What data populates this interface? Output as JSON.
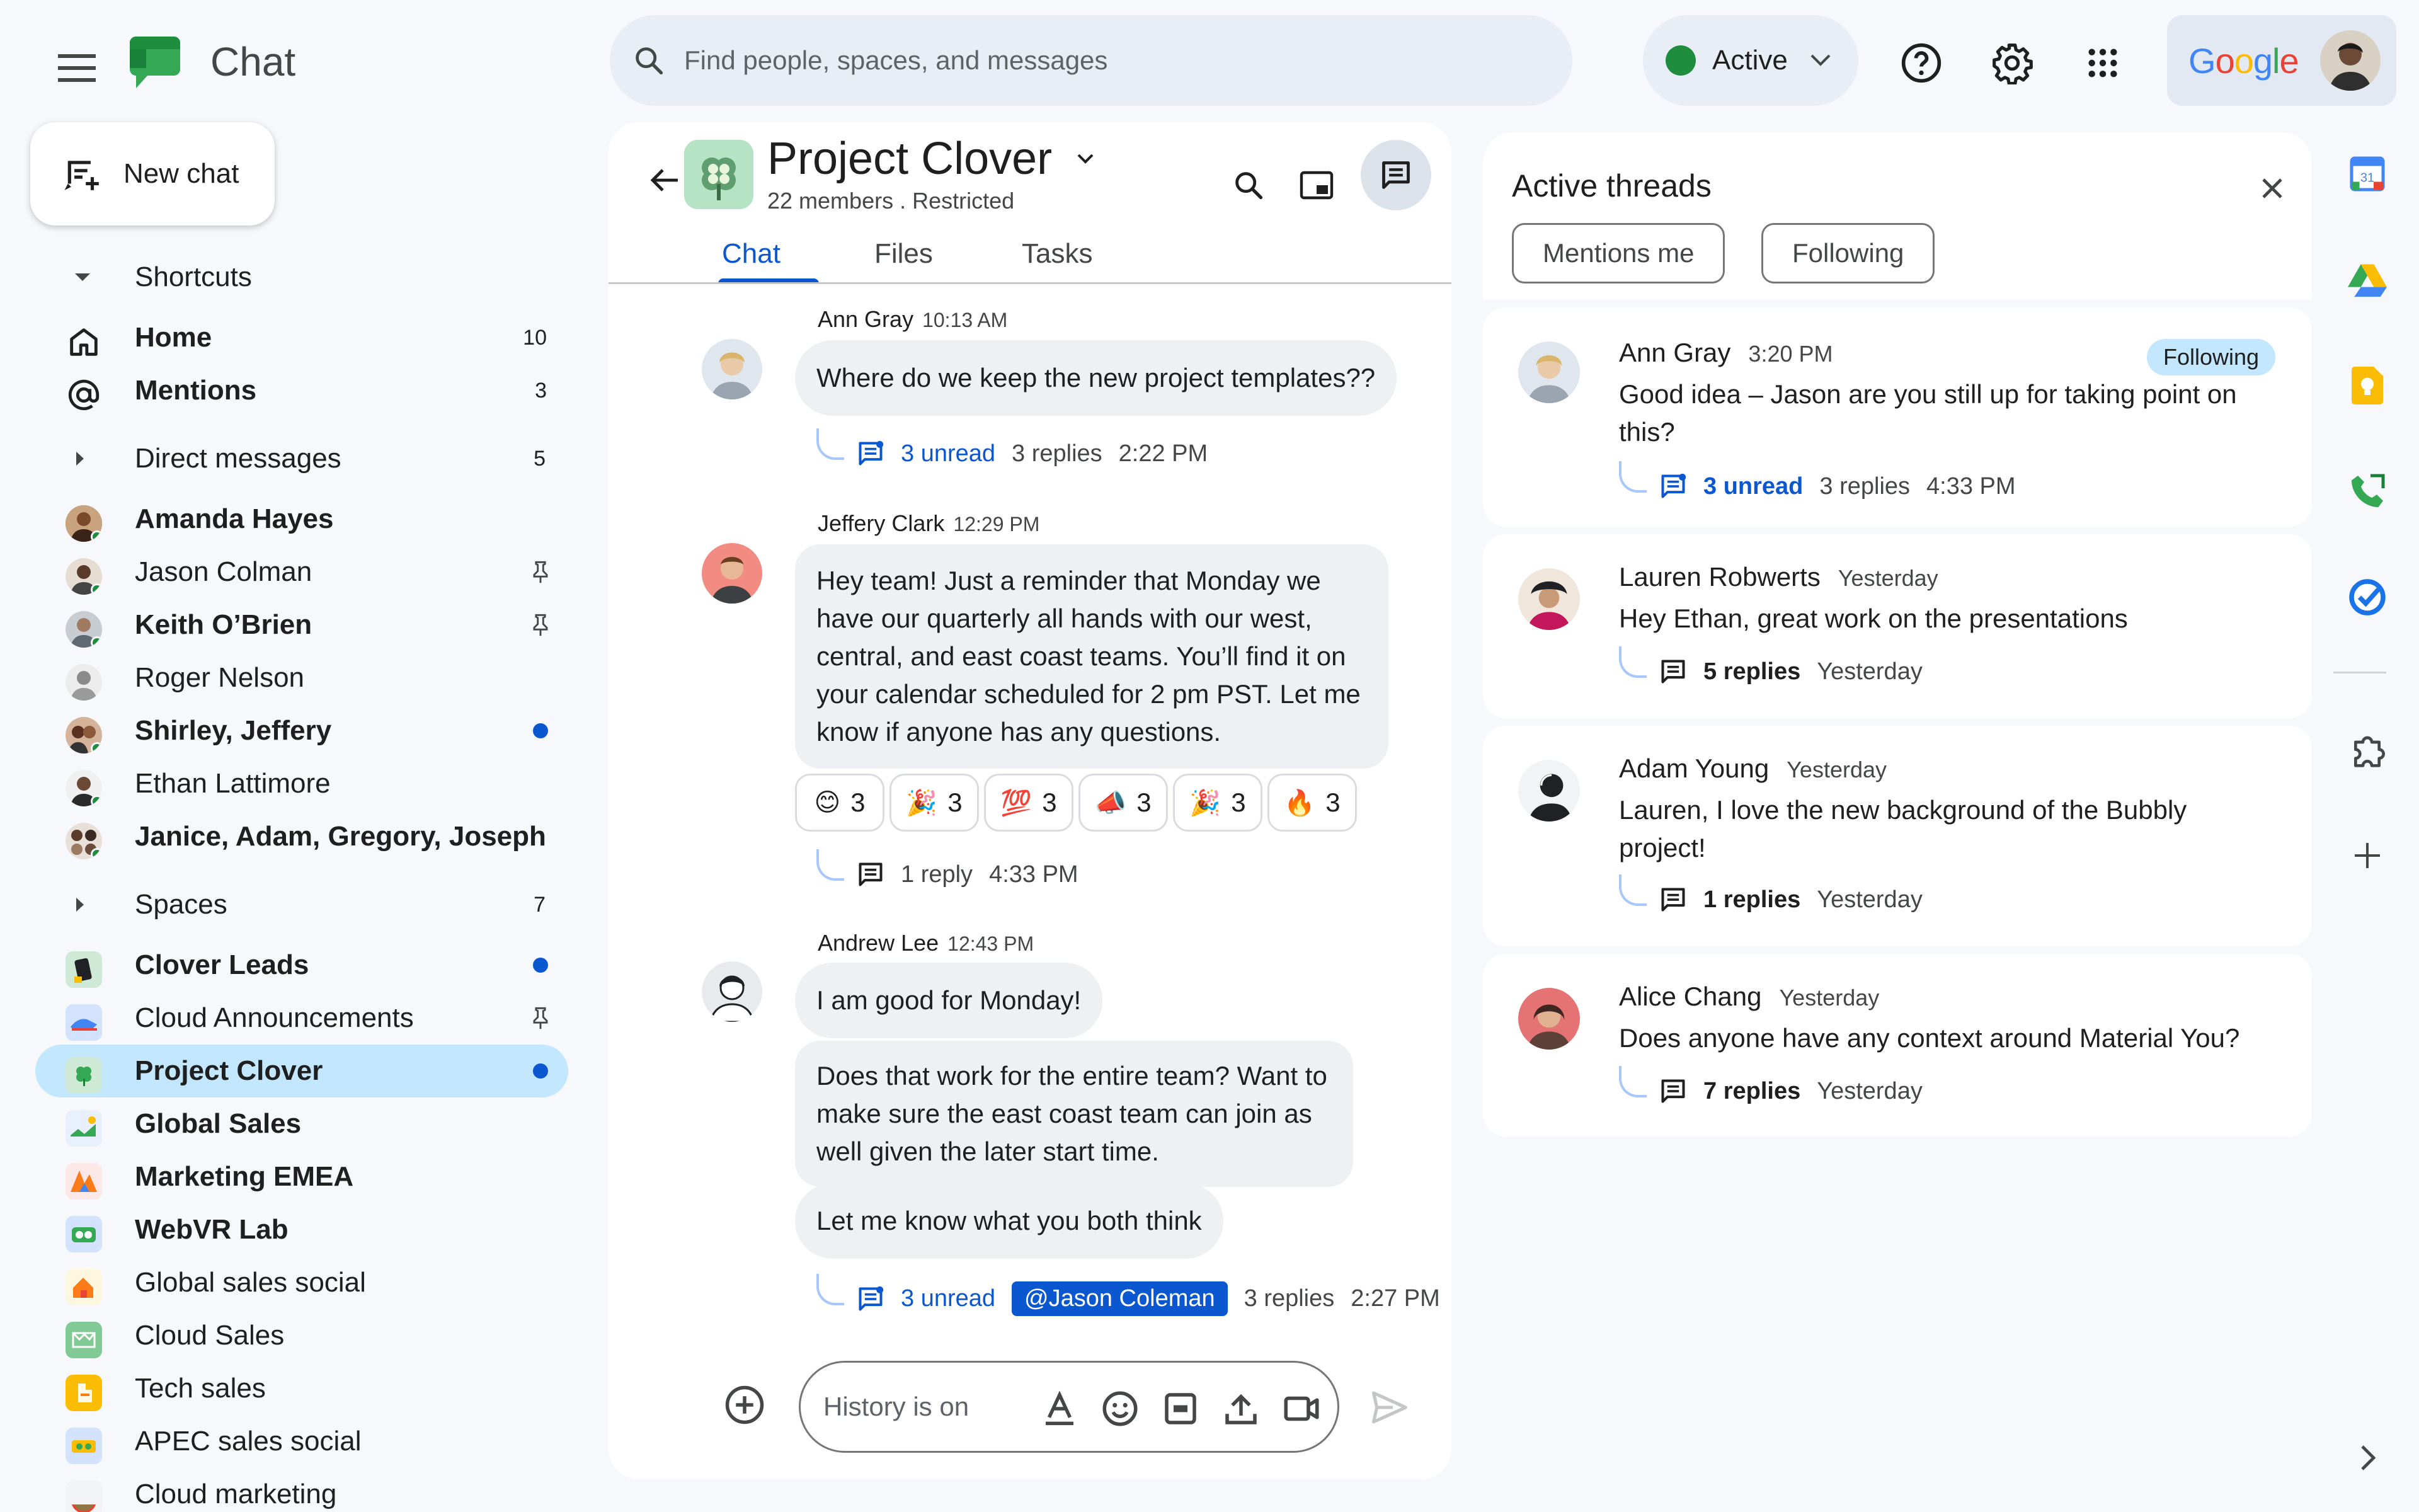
{
  "header": {
    "app_title": "Chat",
    "search_placeholder": "Find people, spaces, and messages",
    "status_label": "Active",
    "google_wordmark": "Google"
  },
  "sidebar": {
    "new_chat_label": "New chat",
    "shortcuts": {
      "label": "Shortcuts",
      "items": [
        {
          "label": "Home",
          "count": "10"
        },
        {
          "label": "Mentions",
          "count": "3"
        }
      ]
    },
    "direct_messages": {
      "label": "Direct messages",
      "count": "5",
      "items": [
        {
          "label": "Amanda Hayes"
        },
        {
          "label": "Jason Colman"
        },
        {
          "label": "Keith O’Brien"
        },
        {
          "label": "Roger Nelson"
        },
        {
          "label": "Shirley, Jeffery"
        },
        {
          "label": "Ethan Lattimore"
        },
        {
          "label": "Janice, Adam, Gregory, Joseph"
        }
      ]
    },
    "spaces": {
      "label": "Spaces",
      "count": "7",
      "items": [
        {
          "label": "Clover Leads"
        },
        {
          "label": "Cloud Announcements"
        },
        {
          "label": "Project Clover"
        },
        {
          "label": "Global Sales"
        },
        {
          "label": "Marketing EMEA"
        },
        {
          "label": "WebVR Lab"
        },
        {
          "label": "Global sales social"
        },
        {
          "label": "Cloud Sales"
        },
        {
          "label": "Tech sales"
        },
        {
          "label": "APEC sales social"
        },
        {
          "label": "Cloud marketing"
        }
      ]
    }
  },
  "space": {
    "title": "Project Clover",
    "subtitle": "22 members . Restricted",
    "tabs": [
      "Chat",
      "Files",
      "Tasks"
    ]
  },
  "messages": [
    {
      "author": "Ann Gray",
      "time": "10:13 AM",
      "bubbles": [
        "Where do we keep the new project templates??"
      ],
      "thread": {
        "unread": "3 unread",
        "replies": "3 replies",
        "time": "2:22 PM"
      }
    },
    {
      "author": "Jeffery Clark",
      "time": "12:29 PM",
      "bubbles": [
        "Hey team! Just a reminder that Monday we have our quarterly all hands with our west, central, and east coast teams. You’ll find it on your calendar scheduled for 2 pm PST. Let me know if anyone has any questions."
      ],
      "reactions": [
        {
          "emoji": "😊",
          "count": "3"
        },
        {
          "emoji": "🎉",
          "count": "3"
        },
        {
          "emoji": "💯",
          "count": "3"
        },
        {
          "emoji": "📣",
          "count": "3"
        },
        {
          "emoji": "🎉",
          "count": "3"
        },
        {
          "emoji": "🔥",
          "count": "3"
        }
      ],
      "thread": {
        "replies": "1 reply",
        "time": "4:33 PM"
      }
    },
    {
      "author": "Andrew Lee",
      "time": "12:43 PM",
      "bubbles": [
        "I am good for Monday!",
        "Does that work for the entire team? Want to make sure the east coast team can join as well given the later start time.",
        "Let me know what you both think"
      ],
      "thread": {
        "unread": "3 unread",
        "mention": "@Jason Coleman",
        "replies": "3 replies",
        "time": "2:27 PM"
      }
    }
  ],
  "composer": {
    "placeholder": "History is on"
  },
  "threads_panel": {
    "title": "Active threads",
    "filters": [
      "Mentions me",
      "Following"
    ],
    "threads": [
      {
        "author": "Ann Gray",
        "time": "3:20 PM",
        "badge": "Following",
        "text": "Good idea – Jason are you still up for taking point on this?",
        "unread": "3 unread",
        "replies": "3 replies",
        "reply_time": "4:33 PM"
      },
      {
        "author": "Lauren Robwerts",
        "time": "Yesterday",
        "text": "Hey Ethan, great work on the presentations",
        "replies": "5 replies",
        "reply_time": "Yesterday"
      },
      {
        "author": "Adam Young",
        "time": "Yesterday",
        "text": "Lauren, I love the new background of the Bubbly project!",
        "replies": "1 replies",
        "reply_time": "Yesterday"
      },
      {
        "author": "Alice Chang",
        "time": "Yesterday",
        "text": "Does anyone have any context around Material You?",
        "replies": "7 replies",
        "reply_time": "Yesterday"
      }
    ]
  },
  "colors": {
    "accent": "#0b57d0",
    "selected": "#c2e7ff",
    "active_status": "#1e8e3e",
    "bubble": "#eef0f2",
    "background": "#f6f8fc"
  }
}
